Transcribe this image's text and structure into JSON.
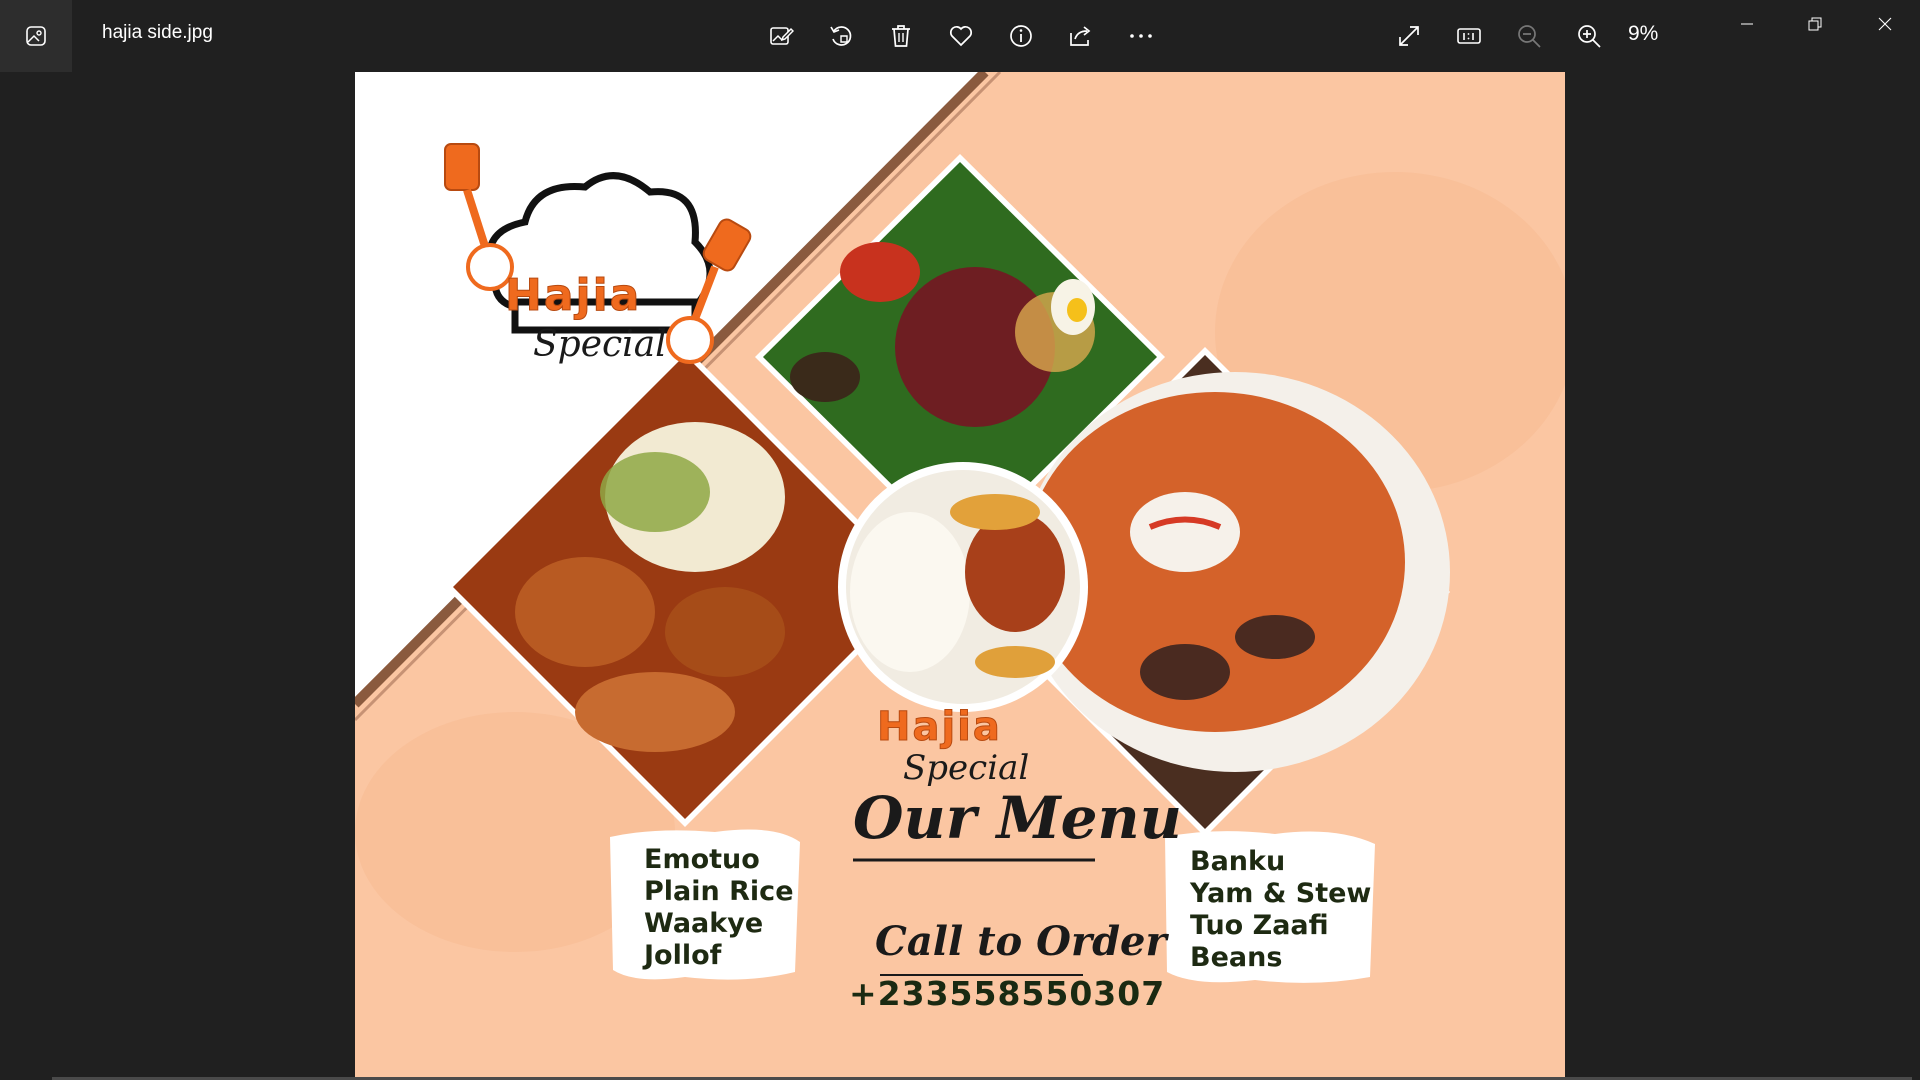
{
  "window": {
    "file_name": "hajia side.jpg",
    "zoom": "9%"
  },
  "toolbar": {
    "icons": [
      "edit-image-icon",
      "rotate-icon",
      "delete-icon",
      "favorite-icon",
      "info-icon",
      "share-icon",
      "more-icon",
      "fullscreen-icon",
      "actual-size-icon",
      "zoom-out-icon",
      "zoom-in-icon"
    ]
  },
  "poster": {
    "brand": "Hajia",
    "brand_script": "Special",
    "center_brand": "Hajia",
    "center_script": "Special",
    "heading": "Our Menu",
    "call_label": "Call to Order",
    "phone": "+233558550307",
    "menu_left": [
      "Emotuo",
      "Plain Rice",
      "Waakye",
      "Jollof"
    ],
    "menu_right": [
      "Banku",
      "Yam & Stew",
      "Tuo Zaafi",
      "Beans"
    ],
    "colors": {
      "orange": "#ef6a1e",
      "peach": "#fbc6a2",
      "dark_text": "#1e2a12"
    }
  }
}
